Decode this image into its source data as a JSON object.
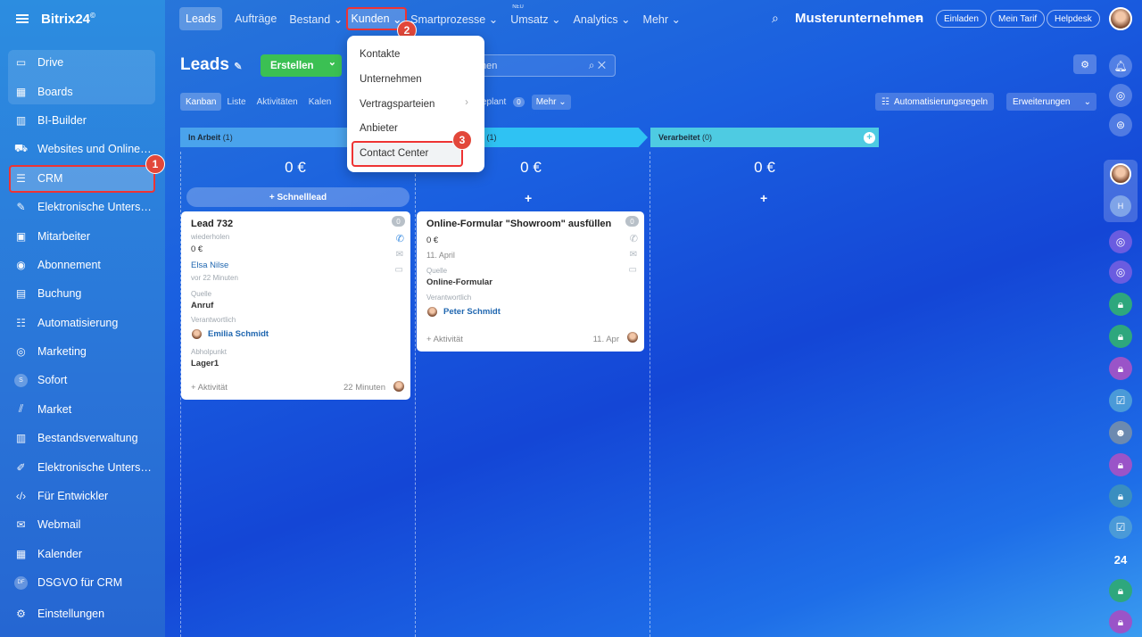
{
  "brand": {
    "name": "Bitrix24",
    "mark": "©"
  },
  "sidebar": {
    "items": [
      {
        "label": "Drive",
        "icon": "drive-icon"
      },
      {
        "label": "Boards",
        "icon": "boards-icon"
      },
      {
        "label": "BI-Builder",
        "icon": "chart-icon"
      },
      {
        "label": "Websites und Onlines...",
        "icon": "cart-icon"
      },
      {
        "label": "CRM",
        "icon": "crm-filter-icon"
      },
      {
        "label": "Elektronische Untersc...",
        "icon": "document-sign-icon"
      },
      {
        "label": "Mitarbeiter",
        "icon": "id-card-icon"
      },
      {
        "label": "Abonnement",
        "icon": "subscription-icon"
      },
      {
        "label": "Buchung",
        "icon": "calendar-booking-icon"
      },
      {
        "label": "Automatisierung",
        "icon": "robot-icon"
      },
      {
        "label": "Marketing",
        "icon": "target-icon"
      },
      {
        "label": "Sofort",
        "icon": "sofort-icon"
      },
      {
        "label": "Market",
        "icon": "market-icon"
      },
      {
        "label": "Bestandsverwaltung",
        "icon": "warehouse-icon"
      },
      {
        "label": "Elektronische Untersc...",
        "icon": "pen-icon"
      },
      {
        "label": "Für Entwickler",
        "icon": "code-icon"
      },
      {
        "label": "Webmail",
        "icon": "mail-icon"
      },
      {
        "label": "Kalender",
        "icon": "calendar-icon"
      },
      {
        "label": "DSGVO für CRM",
        "icon": "dsgvo-icon"
      }
    ],
    "settings": "Einstellungen",
    "sofort_letter": "S",
    "dsgvo_letters": "DF"
  },
  "topnav": {
    "items": [
      "Leads",
      "Aufträge",
      "Bestand",
      "Kunden",
      "Smartprozesse",
      "Umsatz",
      "Analytics",
      "Mehr"
    ],
    "neu": "NEU",
    "company": "Musterunternehmen",
    "invite": "Einladen",
    "tariff": "Mein Tarif",
    "helpdesk": "Helpdesk"
  },
  "page": {
    "title": "Leads",
    "create": "Erstellen",
    "search_placeholder": "hen"
  },
  "tabs": [
    "Kanban",
    "Liste",
    "Aktivitäten",
    "Kalen"
  ],
  "tab_extra": {
    "planned": "eplant",
    "planned_count": "0",
    "more": "Mehr"
  },
  "buttons": {
    "automation": "Automatisierungsregeln",
    "extensions": "Erweiterungen"
  },
  "columns": [
    {
      "name": "In Arbeit",
      "count": "(1)",
      "sum": "0 €",
      "color": "#4aa3ec",
      "quick": "Schnelllead"
    },
    {
      "name": "et",
      "count": "(1)",
      "sum": "0 €",
      "color": "#2fc2f3"
    },
    {
      "name": "Verarbeitet",
      "count": "(0)",
      "sum": "0 €",
      "color": "#4ecbe2"
    }
  ],
  "cards": [
    {
      "title": "Lead 732",
      "count": "0",
      "repeat": "wiederholen",
      "amount": "0 €",
      "contact": "Elsa Nilse",
      "ago": "vor 22 Minuten",
      "source_label": "Quelle",
      "source": "Anruf",
      "resp_label": "Verantwortlich",
      "resp": "Emilia Schmidt",
      "pickup_label": "Abholpunkt",
      "pickup": "Lager1",
      "activity": "+ Aktivität",
      "time": "22 Minuten"
    },
    {
      "title": "Online-Formular \"Showroom\" ausfüllen",
      "count": "0",
      "amount": "0 €",
      "date": "11. April",
      "source_label": "Quelle",
      "source": "Online-Formular",
      "resp_label": "Verantwortlich",
      "resp": "Peter Schmidt",
      "activity": "+ Aktivität",
      "time": "11. Apr"
    }
  ],
  "menu": {
    "items": [
      "Kontakte",
      "Unternehmen",
      "Vertragsparteien",
      "Anbieter",
      "Contact Center"
    ]
  },
  "badges": [
    "1",
    "2",
    "3"
  ],
  "right_rail": {
    "counter": "24",
    "avatar_letter": "H"
  }
}
